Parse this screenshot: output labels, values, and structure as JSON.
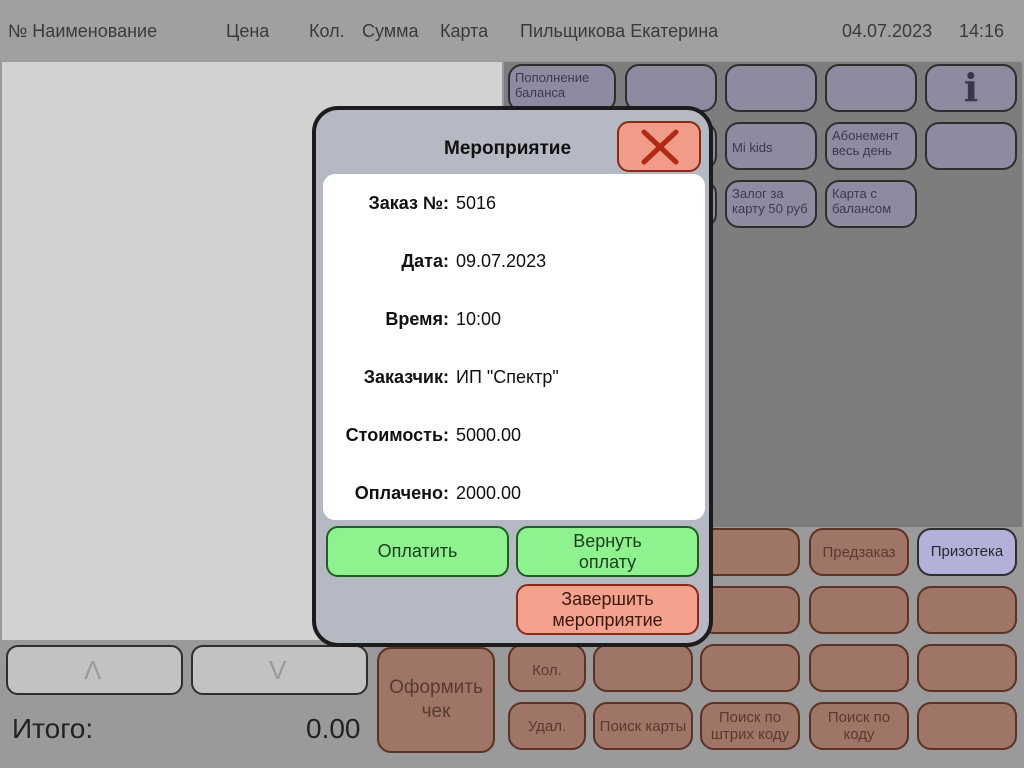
{
  "header": {
    "col_number_name": "№ Наименование",
    "col_price": "Цена",
    "col_qty": "Кол.",
    "col_sum": "Сумма",
    "col_card": "Карта",
    "cashier": "Пильщикова Екатерина",
    "date": "04.07.2023",
    "time": "14:16"
  },
  "item_buttons": {
    "top_up_balance": "Пополнение баланса",
    "mi_kids": "Mi kids",
    "pass_full_day": "Абонемент весь день",
    "deposit_card": "Залог за карту 50 руб",
    "card_with_balance": "Карта с балансом",
    "info_icon_glyph": "i"
  },
  "action_buttons": {
    "preorder": "Предзаказ",
    "prize_library": "Призотека",
    "qty": "Кол.",
    "delete": "Удал.",
    "find_card": "Поиск карты",
    "search_barcode": "Поиск по штрих коду",
    "search_code": "Поиск по коду",
    "checkout": "Оформить чек"
  },
  "scroll": {
    "up_glyph": "Λ",
    "down_glyph": "V"
  },
  "totals": {
    "label": "Итого:",
    "value": "0.00"
  },
  "modal": {
    "title": "Мероприятие",
    "fields": [
      {
        "label": "Заказ №:",
        "value": "5016"
      },
      {
        "label": "Дата:",
        "value": "09.07.2023"
      },
      {
        "label": "Время:",
        "value": "10:00"
      },
      {
        "label": "Заказчик:",
        "value": "ИП \"Спектр\""
      },
      {
        "label": "Стоимость:",
        "value": "5000.00"
      },
      {
        "label": "Оплачено:",
        "value": "2000.00"
      }
    ],
    "pay_button": "Оплатить",
    "refund_button": "Вернуть оплату",
    "finish_button": "Завершить мероприятие"
  },
  "colors": {
    "lavender": "#b3b0d9",
    "salmon": "#f4a28e",
    "green": "#8ef28e",
    "close_x": "#b02a14"
  }
}
